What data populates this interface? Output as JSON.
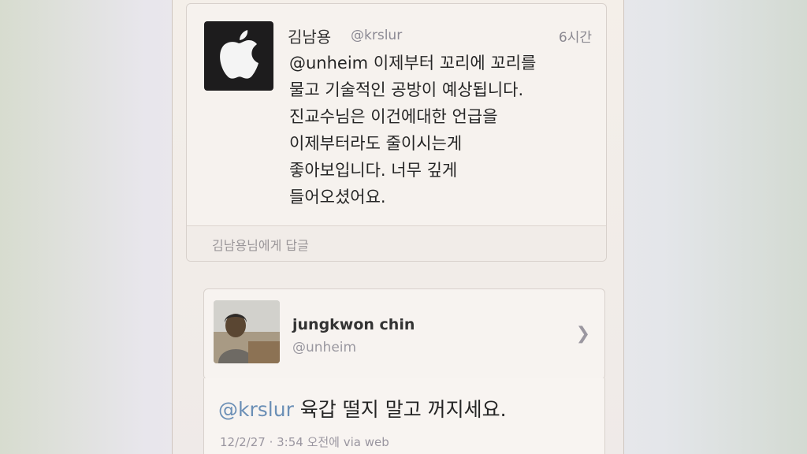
{
  "tweet": {
    "author_name": "김남용",
    "author_handle": "@krslur",
    "time": "6시간",
    "lines": [
      "@unheim 이제부터 꼬리에 꼬리를",
      "물고 기술적인 공방이 예상됩니다.",
      "진교수님은 이건에대한 언급을",
      "이제부터라도 줄이시는게",
      "좋아보입니다. 너무 깊게",
      "들어오셨어요."
    ],
    "reply_placeholder": "김남용님에게 답글"
  },
  "profile": {
    "name": "jungkwon chin",
    "handle": "@unheim"
  },
  "reply": {
    "mention": "@krslur",
    "text": " 육갑 떨지 말고 꺼지세요.",
    "meta": "12/2/27 · 3:54 오전에 via web"
  },
  "colors": {
    "mention": "#6b8fb6",
    "avatar_bg": "#1d1c1d"
  },
  "icons": {
    "apple_logo": "apple-logo-icon",
    "chevron": "chevron-right-icon"
  }
}
